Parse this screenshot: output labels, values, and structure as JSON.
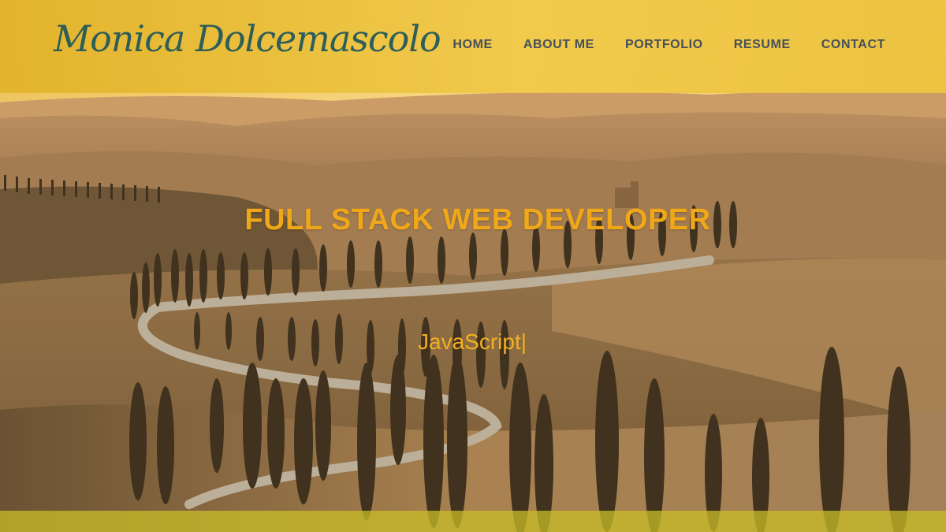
{
  "site": {
    "logo": "Monica Dolcemascolo"
  },
  "nav": {
    "items": [
      {
        "label": "HOME"
      },
      {
        "label": "ABOUT ME"
      },
      {
        "label": "PORTFOLIO"
      },
      {
        "label": "RESUME"
      },
      {
        "label": "CONTACT"
      }
    ]
  },
  "hero": {
    "title": "FULL STACK WEB DEVELOPER",
    "typed_text": "JavaScript",
    "cursor": "|"
  },
  "colors": {
    "header_bg": "#e8bc3a",
    "logo": "#2f5e58",
    "nav_text": "#45505a",
    "hero_accent": "#f0a818"
  }
}
